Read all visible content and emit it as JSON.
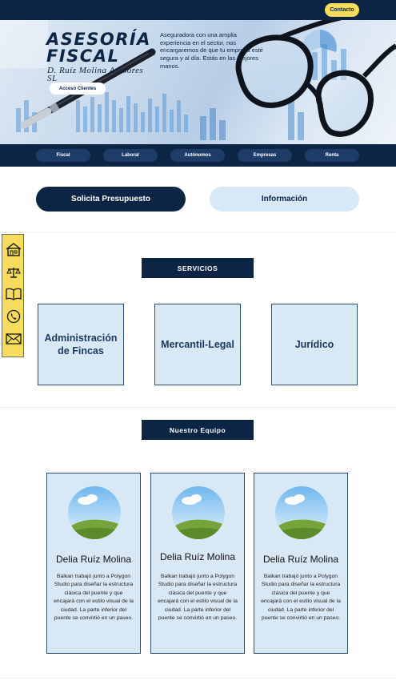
{
  "header": {
    "contact_label": "Contacto"
  },
  "hero": {
    "title": "ASESORÍA FISCAL",
    "subtitle": "D. Ruíz Molina Asesores SL",
    "clients_label": "Acceso Clientes",
    "description": "Aseguradora con una amplia experiencia en el sector, nos encargaremos de que tu empresa esté segura y al día. Estás en las mejores manos."
  },
  "nav": {
    "items": [
      "Fiscal",
      "Laboral",
      "Autónomos",
      "Empresas",
      "Renta"
    ]
  },
  "cta": {
    "primary_label": "Solicita Presupuesto",
    "secondary_label": "Información"
  },
  "side_panel": {
    "icons": [
      "home-icon",
      "scale-icon",
      "book-icon",
      "phone-icon",
      "envelope-icon"
    ]
  },
  "services": {
    "heading": "SERVICIOS",
    "cards": [
      "Administración de Fincas",
      "Mercantil-Legal",
      "Jurídico"
    ]
  },
  "team": {
    "heading": "Nuestro Equipo",
    "members": [
      {
        "name": "Delia Ruíz Molina",
        "bio": "Balkan trabajó junto a Polygon Studio para diseñar la estructura clásica del puente y que encajará con el estilo visual de la ciudad. La parte inferior del puente se convirtió en un paseo."
      },
      {
        "name": "Delia Ruíz Molina",
        "bio": "Balkan trabajó junto a Polygon Studio para diseñar la estructura clásica del puente y que encajará con el estilo visual de la ciudad. La parte inferior del puente se convirtió en un paseo."
      },
      {
        "name": "Delia Ruíz Molina",
        "bio": "Balkan trabajó junto a Polygon Studio para diseñar la estructura clásica del puente y que encajará con el estilo visual de la ciudad. La parte inferior del puente se convirtió en un paseo."
      }
    ]
  },
  "colors": {
    "navy": "#0c2545",
    "accent_yellow": "#f6dc5c",
    "card_blue": "#d9e8f5"
  }
}
